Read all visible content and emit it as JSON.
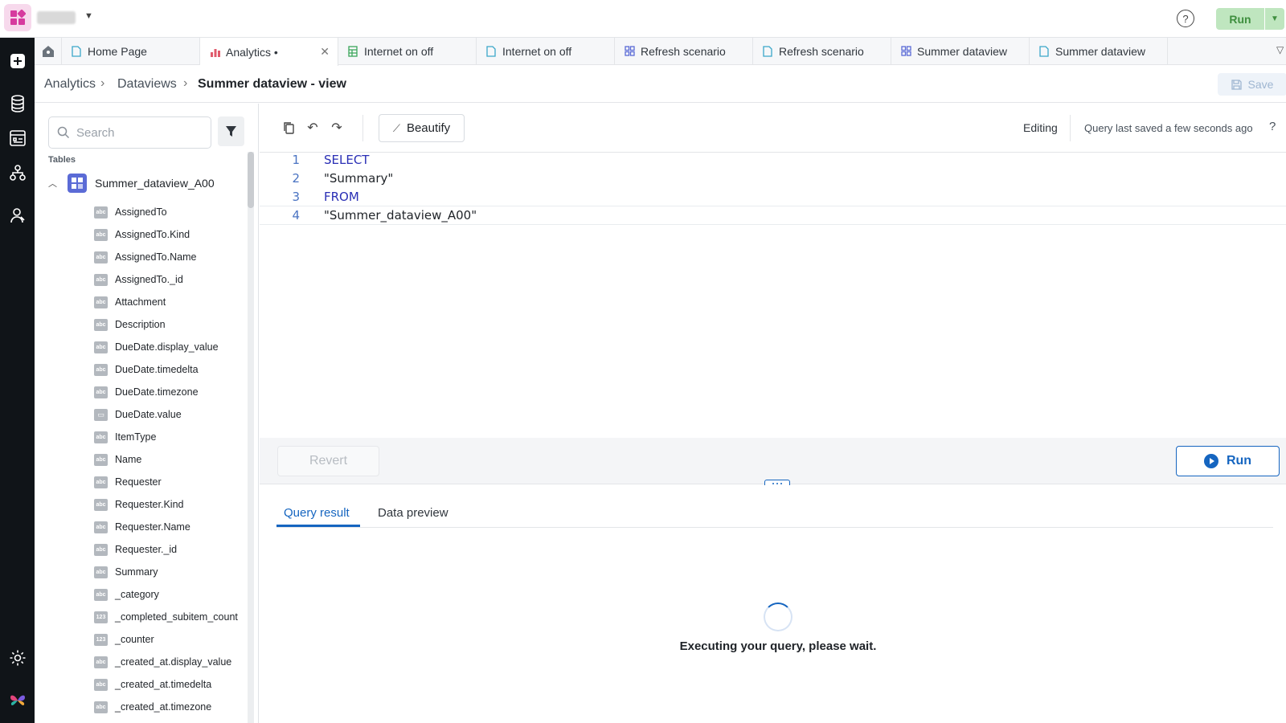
{
  "topbar": {
    "run_label": "Run",
    "help_icon": "question-circle-icon"
  },
  "rail": {
    "icons": [
      "plus-icon",
      "database-icon",
      "dashboard-icon",
      "hierarchy-icon",
      "users-icon",
      "settings-icon",
      "butterfly-logo-icon"
    ]
  },
  "tabs": [
    {
      "label": "Home Page",
      "icon": "page-icon"
    },
    {
      "label": "Analytics •",
      "icon": "chart-icon",
      "active": true
    },
    {
      "label": "Internet on off",
      "icon": "sheet-icon"
    },
    {
      "label": "Internet on off",
      "icon": "page-icon"
    },
    {
      "label": "Refresh scenario",
      "icon": "grid-icon"
    },
    {
      "label": "Refresh scenario",
      "icon": "page-icon"
    },
    {
      "label": "Summer dataview",
      "icon": "grid-icon"
    },
    {
      "label": "Summer dataview",
      "icon": "page-icon"
    }
  ],
  "breadcrumb": {
    "items": [
      "Analytics",
      "Dataviews",
      "Summer dataview - view"
    ]
  },
  "save_label": "Save",
  "sidebar": {
    "search_placeholder": "Search",
    "tables_label": "Tables",
    "table_name": "Summer_dataview_A00",
    "columns": [
      {
        "name": "AssignedTo",
        "type": "abc"
      },
      {
        "name": "AssignedTo.Kind",
        "type": "abc"
      },
      {
        "name": "AssignedTo.Name",
        "type": "abc"
      },
      {
        "name": "AssignedTo._id",
        "type": "abc"
      },
      {
        "name": "Attachment",
        "type": "abc"
      },
      {
        "name": "Description",
        "type": "abc"
      },
      {
        "name": "DueDate.display_value",
        "type": "abc"
      },
      {
        "name": "DueDate.timedelta",
        "type": "abc"
      },
      {
        "name": "DueDate.timezone",
        "type": "abc"
      },
      {
        "name": "DueDate.value",
        "type": "date"
      },
      {
        "name": "ItemType",
        "type": "abc"
      },
      {
        "name": "Name",
        "type": "abc"
      },
      {
        "name": "Requester",
        "type": "abc"
      },
      {
        "name": "Requester.Kind",
        "type": "abc"
      },
      {
        "name": "Requester.Name",
        "type": "abc"
      },
      {
        "name": "Requester._id",
        "type": "abc"
      },
      {
        "name": "Summary",
        "type": "abc"
      },
      {
        "name": "_category",
        "type": "abc"
      },
      {
        "name": "_completed_subitem_count",
        "type": "123"
      },
      {
        "name": "_counter",
        "type": "123"
      },
      {
        "name": "_created_at.display_value",
        "type": "abc"
      },
      {
        "name": "_created_at.timedelta",
        "type": "abc"
      },
      {
        "name": "_created_at.timezone",
        "type": "abc"
      }
    ]
  },
  "editor": {
    "beautify_label": "Beautify",
    "mode_label": "Editing",
    "saved_status": "Query last saved a few seconds ago",
    "help_label": "?",
    "lines": [
      {
        "n": "1",
        "text": "SELECT",
        "kind": "kw"
      },
      {
        "n": "2",
        "text": "\"Summary\"",
        "kind": "str"
      },
      {
        "n": "3",
        "text": "FROM",
        "kind": "kw"
      },
      {
        "n": "4",
        "text": "\"Summer_dataview_A00\"",
        "kind": "str"
      }
    ]
  },
  "actions": {
    "revert_label": "Revert",
    "run_label": "Run"
  },
  "results": {
    "tabs": [
      "Query result",
      "Data preview"
    ],
    "message": "Executing your query, please wait."
  }
}
